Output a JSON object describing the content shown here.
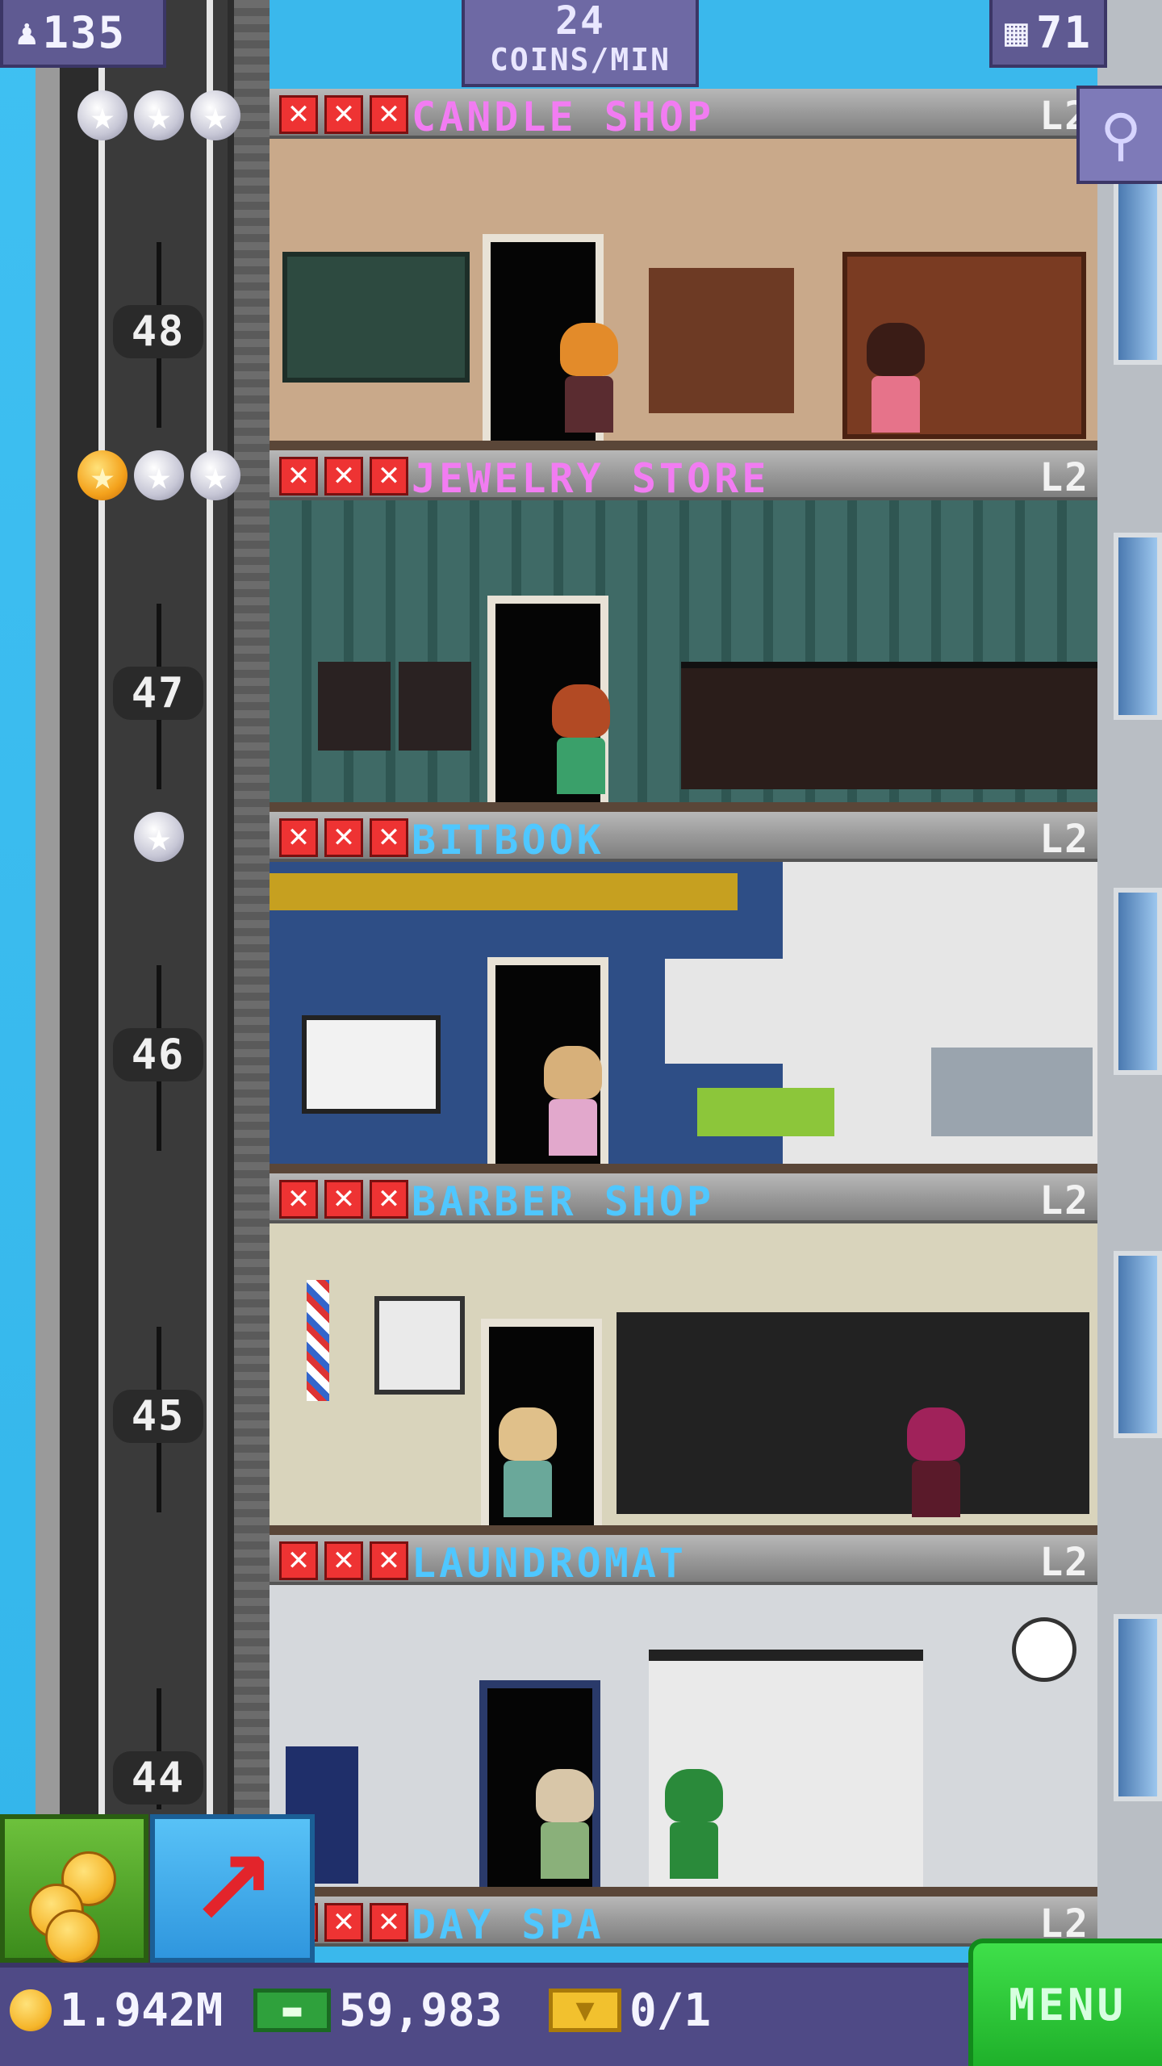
{
  "hud": {
    "population": "135",
    "coins_per_min_value": "24",
    "coins_per_min_unit": "COINS/MIN",
    "floor_count": "71"
  },
  "shaft_floor_numbers": [
    "48",
    "47",
    "46",
    "45",
    "44"
  ],
  "floors": [
    {
      "name": "CANDLE SHOP",
      "level": "L2",
      "name_color": "#f27cf2",
      "stars_filled": 0,
      "stars_total": 3
    },
    {
      "name": "JEWELRY STORE",
      "level": "L2",
      "name_color": "#f27cf2",
      "stars_filled": 1,
      "stars_total": 3
    },
    {
      "name": "BITBOOK",
      "level": "L2",
      "name_color": "#4fc7ff",
      "stars_filled": 0,
      "stars_total": 1
    },
    {
      "name": "BARBER SHOP",
      "level": "L2",
      "name_color": "#4fc7ff",
      "stars_filled": 0,
      "stars_total": 0
    },
    {
      "name": "LAUNDROMAT",
      "level": "L2",
      "name_color": "#4fc7ff",
      "stars_filled": 0,
      "stars_total": 0
    },
    {
      "name": "DAY SPA",
      "level": "L2",
      "name_color": "#4fc7ff",
      "stars_filled": 0,
      "stars_total": 0
    }
  ],
  "bottom_bar": {
    "coins": "1.942M",
    "bux": "59,983",
    "tickets": "0/1",
    "menu_label": "MENU"
  },
  "icons": {
    "population": "person-icon",
    "floors": "building-icon",
    "search": "magnifier-icon",
    "coins_button": "coins-icon",
    "lift_button": "up-arrow-icon"
  }
}
